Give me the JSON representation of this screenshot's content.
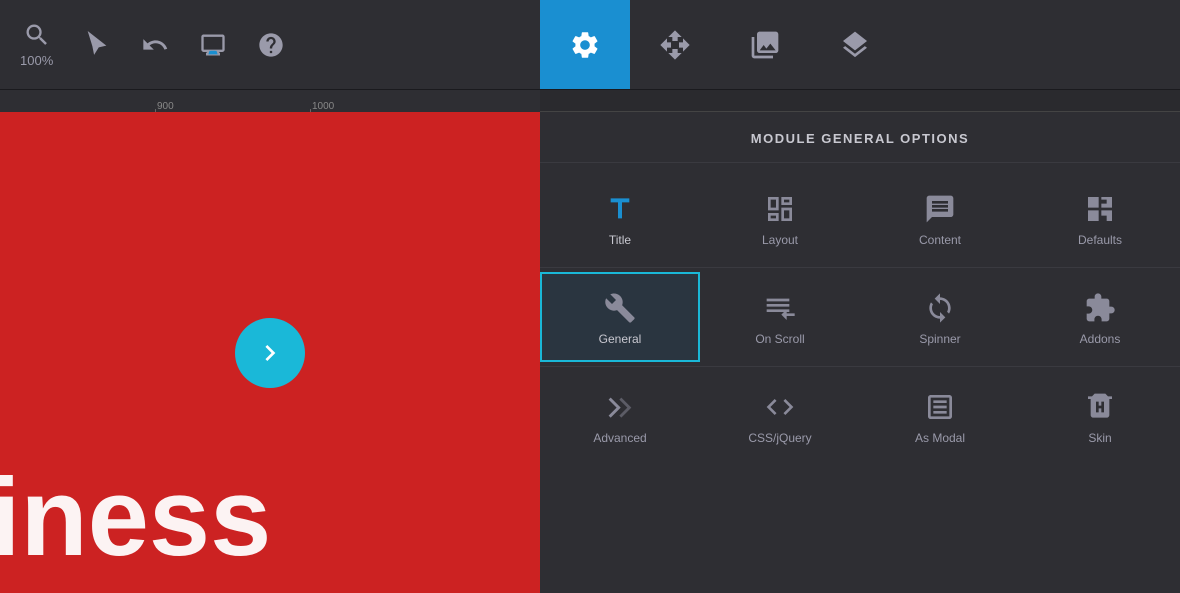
{
  "toolbar": {
    "zoom_label": "100%",
    "tabs": [
      {
        "id": "search",
        "label": "Search",
        "icon": "search"
      },
      {
        "id": "cursor",
        "label": "Cursor",
        "icon": "cursor"
      },
      {
        "id": "undo",
        "label": "Undo",
        "icon": "undo"
      },
      {
        "id": "monitor",
        "label": "Monitor",
        "icon": "monitor"
      },
      {
        "id": "help",
        "label": "Help",
        "icon": "help"
      },
      {
        "id": "settings",
        "label": "Settings",
        "icon": "settings",
        "active": true
      },
      {
        "id": "move",
        "label": "Move",
        "icon": "move"
      },
      {
        "id": "media",
        "label": "Media",
        "icon": "media"
      },
      {
        "id": "layers",
        "label": "Layers",
        "icon": "layers"
      }
    ]
  },
  "panel": {
    "title": "MODULE GENERAL OPTIONS",
    "modules": [
      {
        "id": "title",
        "label": "Title",
        "icon": "title",
        "active": false,
        "title_style": true
      },
      {
        "id": "layout",
        "label": "Layout",
        "icon": "layout"
      },
      {
        "id": "content",
        "label": "Content",
        "icon": "content"
      },
      {
        "id": "defaults",
        "label": "Defaults",
        "icon": "defaults"
      },
      {
        "id": "general",
        "label": "General",
        "icon": "wrench",
        "active": true
      },
      {
        "id": "on-scroll",
        "label": "On Scroll",
        "icon": "on-scroll"
      },
      {
        "id": "spinner",
        "label": "Spinner",
        "icon": "spinner"
      },
      {
        "id": "addons",
        "label": "Addons",
        "icon": "puzzle"
      },
      {
        "id": "advanced",
        "label": "Advanced",
        "icon": "advanced"
      },
      {
        "id": "css-jquery",
        "label": "CSS/jQuery",
        "icon": "code"
      },
      {
        "id": "as-modal",
        "label": "As Modal",
        "icon": "modal"
      },
      {
        "id": "skin",
        "label": "Skin",
        "icon": "skin"
      }
    ]
  },
  "canvas": {
    "text": "iness"
  },
  "ruler": {
    "marks": [
      "900",
      "1000"
    ]
  }
}
